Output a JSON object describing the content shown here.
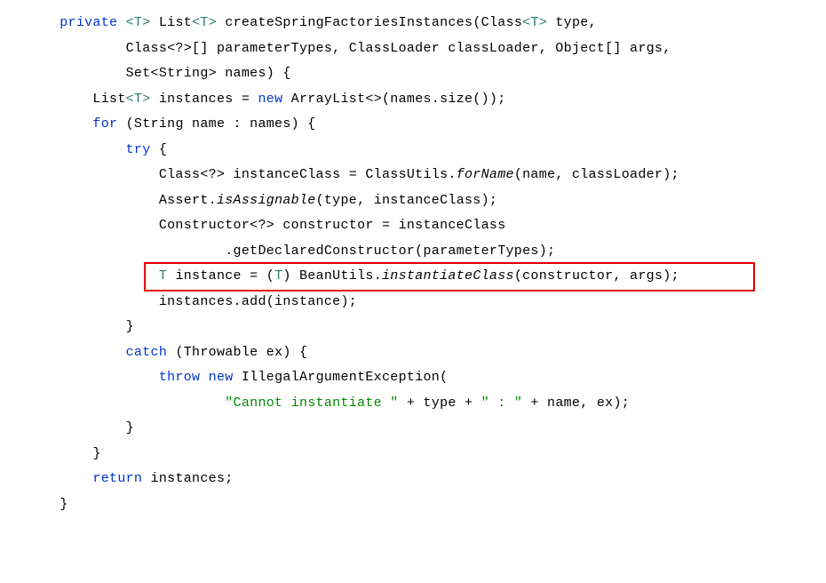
{
  "code": {
    "l1_kw1": "private",
    "l1_tp": "<T>",
    "l1_type": "List",
    "l1_tp2": "<T>",
    "l1_method": "createSpringFactoriesInstances",
    "l1_params": "(Class",
    "l1_tp3": "<T>",
    "l1_rest": " type,",
    "l2": "Class<?>[] parameterTypes, ClassLoader classLoader, Object[] args,",
    "l3": "Set<String> names) {",
    "l4_type": "List",
    "l4_tp": "<T>",
    "l4_var": " instances = ",
    "l4_kw": "new",
    "l4_rest": " ArrayList<>(names.size());",
    "l5_kw": "for",
    "l5_rest": " (String name : names) {",
    "l6_kw": "try",
    "l6_rest": " {",
    "l7_a": "Class<?> instanceClass = ClassUtils.",
    "l7_b": "forName",
    "l7_c": "(name, classLoader);",
    "l8_a": "Assert.",
    "l8_b": "isAssignable",
    "l8_c": "(type, instanceClass);",
    "l9": "Constructor<?> constructor = instanceClass",
    "l10": ".getDeclaredConstructor(parameterTypes);",
    "l11_tp": "T",
    "l11_a": " instance = (",
    "l11_tp2": "T",
    "l11_b": ") BeanUtils.",
    "l11_c": "instantiateClass",
    "l11_d": "(constructor, args);",
    "l12": "instances.add(instance);",
    "l13": "}",
    "l14_kw": "catch",
    "l14_rest": " (Throwable ex) {",
    "l15_kw1": "throw",
    "l15_kw2": "new",
    "l15_rest": " IllegalArgumentException(",
    "l16_str": "\"Cannot instantiate \"",
    "l16_a": " + type + ",
    "l16_str2": "\" : \"",
    "l16_b": " + name, ex);",
    "l17": "}",
    "l18": "}",
    "l19_kw": "return",
    "l19_rest": " instances;",
    "l20": "}"
  }
}
